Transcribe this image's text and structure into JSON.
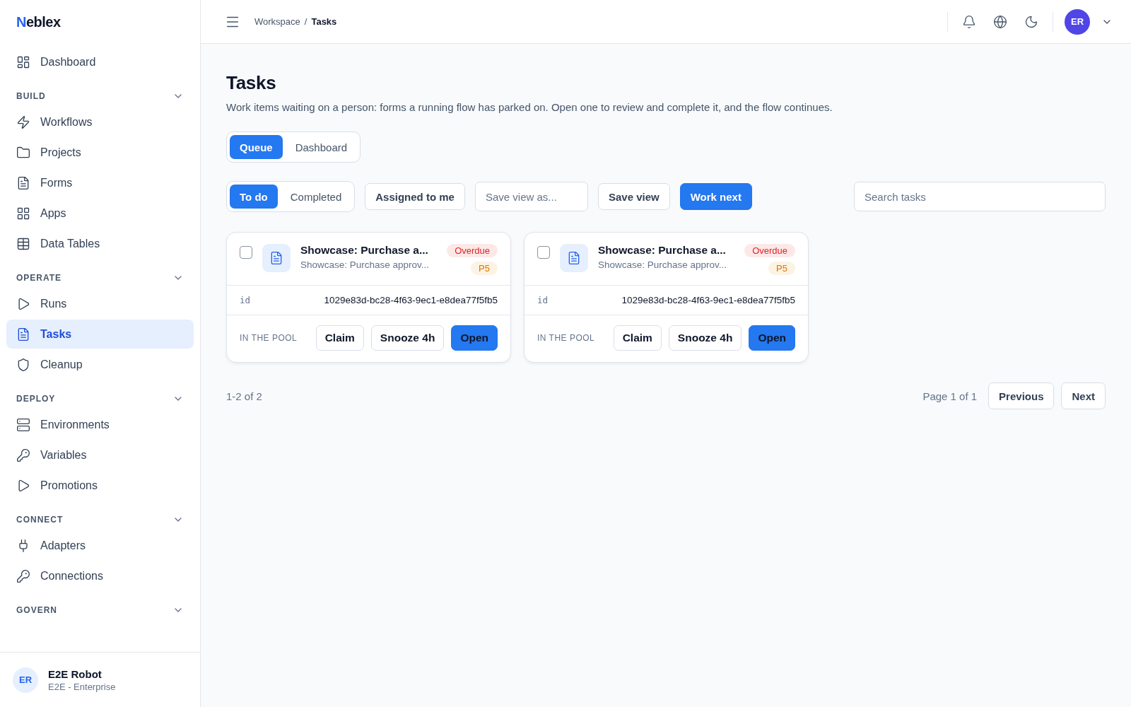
{
  "brand": "Neblex",
  "sidebar": {
    "top_item": {
      "label": "Dashboard",
      "selected": false
    },
    "sections": [
      {
        "title": "BUILD",
        "expanded": true,
        "items": [
          {
            "label": "Workflows",
            "selected": false
          },
          {
            "label": "Projects",
            "selected": false
          },
          {
            "label": "Forms",
            "selected": false
          },
          {
            "label": "Apps",
            "selected": false
          },
          {
            "label": "Data Tables",
            "selected": false
          }
        ]
      },
      {
        "title": "OPERATE",
        "expanded": true,
        "items": [
          {
            "label": "Runs",
            "selected": false
          },
          {
            "label": "Tasks",
            "selected": true
          },
          {
            "label": "Cleanup",
            "selected": false
          }
        ]
      },
      {
        "title": "DEPLOY",
        "expanded": true,
        "items": [
          {
            "label": "Environments",
            "selected": false
          },
          {
            "label": "Variables",
            "selected": false
          },
          {
            "label": "Promotions",
            "selected": false
          }
        ]
      },
      {
        "title": "CONNECT",
        "expanded": true,
        "items": [
          {
            "label": "Adapters",
            "selected": false
          },
          {
            "label": "Connections",
            "selected": false
          }
        ]
      },
      {
        "title": "GOVERN",
        "expanded": true
      }
    ],
    "user": {
      "initials": "ER",
      "name": "E2E Robot",
      "org": "E2E - Enterprise"
    }
  },
  "breadcrumb": [
    "Workspace",
    "Tasks"
  ],
  "breadcrumb_separator": "/",
  "header_user": {
    "initials": "ER"
  },
  "page": {
    "title": "Tasks",
    "description": "Work items waiting on a person: forms a running flow has parked on. Open one to review and complete it, and the flow continues."
  },
  "view_tabs": [
    {
      "label": "Queue",
      "selected": true
    },
    {
      "label": "Dashboard",
      "selected": false
    }
  ],
  "filter_tabs": [
    {
      "label": "To do",
      "selected": true
    },
    {
      "label": "Completed",
      "selected": false
    }
  ],
  "assigned_filter": {
    "label": "Assigned to me",
    "selected": false
  },
  "save_view_field": {
    "placeholder": "Save view as..."
  },
  "save_view_button": "Save view",
  "work_next_button": "Work next",
  "search": {
    "placeholder": "Search tasks"
  },
  "tasks": [
    {
      "checked": false,
      "title": "Showcase: Purchase a...",
      "subtitle": "Showcase: Purchase approv...",
      "status": "Overdue",
      "priority": "P5",
      "field_label": "id",
      "field_value": "1029e83d-bc28-4f63-9ec1-e8dea77f5fb5",
      "pool": "IN THE POOL",
      "actions": [
        "Claim",
        "Snooze 4h",
        "Open"
      ]
    },
    {
      "checked": false,
      "title": "Showcase: Purchase a...",
      "subtitle": "Showcase: Purchase approv...",
      "status": "Overdue",
      "priority": "P5",
      "field_label": "id",
      "field_value": "1029e83d-bc28-4f63-9ec1-e8dea77f5fb5",
      "pool": "IN THE POOL",
      "actions": [
        "Claim",
        "Snooze 4h",
        "Open"
      ]
    }
  ],
  "pagination": {
    "range": "1-2 of 2",
    "page": "Page 1 of 1",
    "previous": "Previous",
    "next": "Next"
  }
}
